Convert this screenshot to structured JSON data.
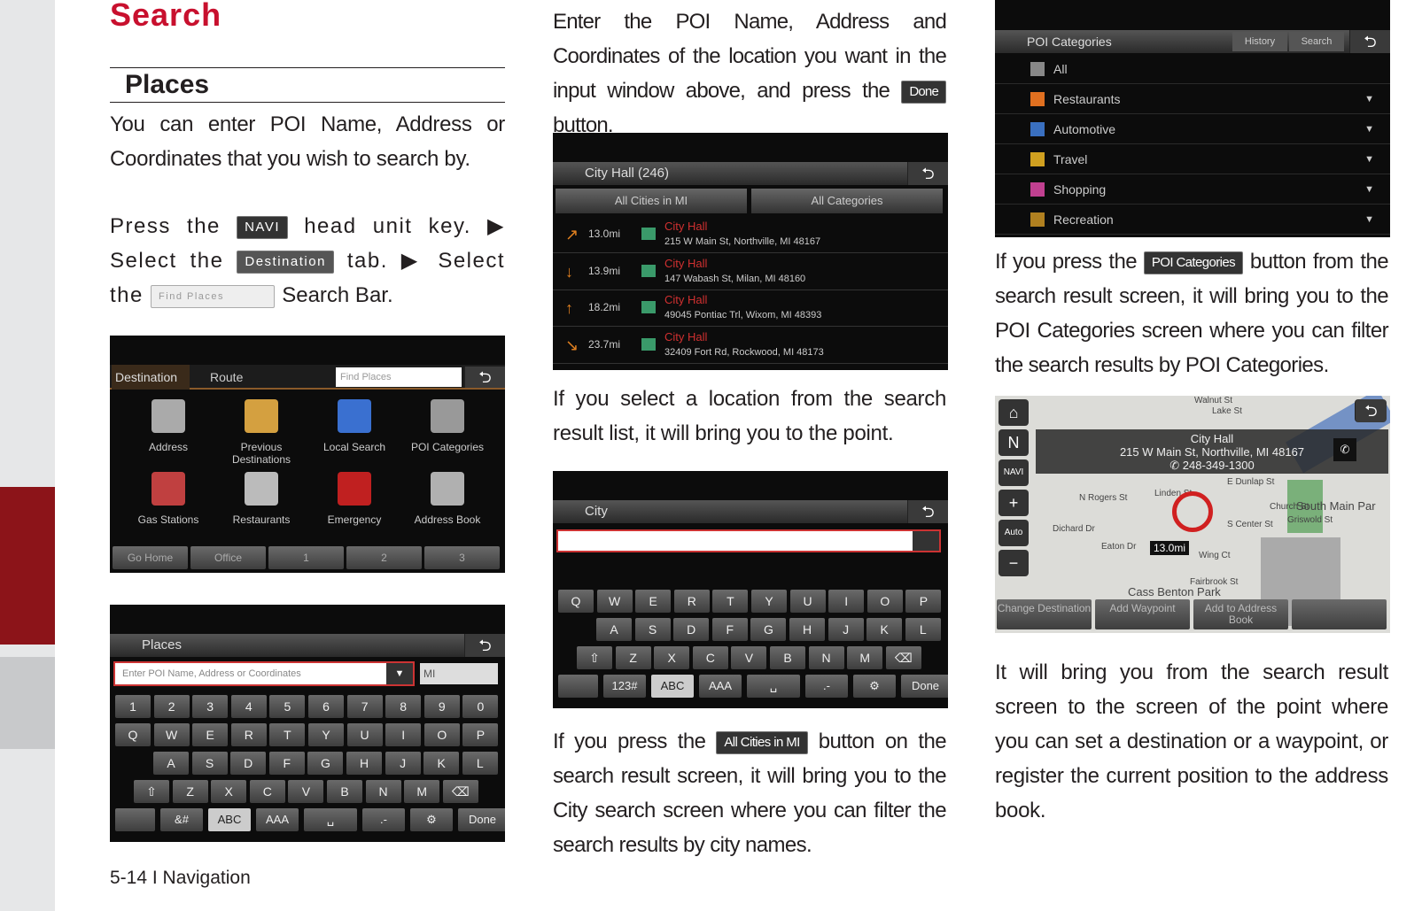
{
  "page": {
    "title": "Search",
    "section": "Places",
    "footer": "5-14 I Navigation"
  },
  "col1": {
    "intro": "You can enter POI Name, Address or Coordinates that you wish to search by.",
    "step_a": "Press the",
    "navi_chip": "NAVI",
    "step_b": "head unit key. ▶ Select the",
    "dest_chip": "Destination",
    "step_c": "tab. ▶ Select the",
    "find_chip": "Find Places",
    "step_d": "Search Bar."
  },
  "screen1": {
    "tabs": [
      "Destination",
      "Route"
    ],
    "search_placeholder": "Find Places",
    "items": [
      "Address",
      "Previous Destinations",
      "Local Search",
      "POI Categories",
      "Gas Stations",
      "Restaurants",
      "Emergency",
      "Address Book"
    ],
    "shortcuts": [
      "Go Home",
      "Office",
      "1",
      "2",
      "3"
    ]
  },
  "screen2": {
    "title": "Places",
    "input_placeholder": "Enter POI Name, Address or Coordinates",
    "state": "MI",
    "rows": [
      [
        "1",
        "2",
        "3",
        "4",
        "5",
        "6",
        "7",
        "8",
        "9",
        "0"
      ],
      [
        "Q",
        "W",
        "E",
        "R",
        "T",
        "Y",
        "U",
        "I",
        "O",
        "P"
      ],
      [
        "A",
        "S",
        "D",
        "F",
        "G",
        "H",
        "J",
        "K",
        "L"
      ],
      [
        "⇧",
        "Z",
        "X",
        "C",
        "V",
        "B",
        "N",
        "M",
        "⌫"
      ]
    ],
    "bottom": [
      "",
      "&#",
      "ABC",
      "AAA",
      "␣",
      ".-",
      "⚙",
      "Done"
    ]
  },
  "col2": {
    "p1a": "Enter the POI Name, Address and Coordinates of the location you want in the input window above, and press the",
    "done_chip": "Done",
    "p1b": "button.",
    "p2": "If you select a location from the search result list, it will bring you to the point.",
    "p3a": "If you press the",
    "allcities_chip": "All Cities in MI",
    "p3b": "button on the search result screen, it will bring you to the City search screen where you can filter the search results by city names."
  },
  "screen3": {
    "title": "City Hall (246)",
    "filters": [
      "All Cities in MI",
      "All Categories"
    ],
    "results": [
      {
        "dist": "13.0mi",
        "name": "City Hall",
        "addr": "215 W Main St, Northville, MI 48167",
        "arrow": "↗"
      },
      {
        "dist": "13.9mi",
        "name": "City Hall",
        "addr": "147 Wabash St, Milan, MI 48160",
        "arrow": "↓"
      },
      {
        "dist": "18.2mi",
        "name": "City Hall",
        "addr": "49045 Pontiac Trl, Wixom, MI 48393",
        "arrow": "↑"
      },
      {
        "dist": "23.7mi",
        "name": "City Hall",
        "addr": "32409 Fort Rd, Rockwood, MI 48173",
        "arrow": "↘"
      }
    ]
  },
  "screen4": {
    "title": "City",
    "rows": [
      [
        "Q",
        "W",
        "E",
        "R",
        "T",
        "Y",
        "U",
        "I",
        "O",
        "P"
      ],
      [
        "A",
        "S",
        "D",
        "F",
        "G",
        "H",
        "J",
        "K",
        "L"
      ],
      [
        "⇧",
        "Z",
        "X",
        "C",
        "V",
        "B",
        "N",
        "M",
        "⌫"
      ]
    ],
    "bottom": [
      "",
      "123#",
      "ABC",
      "AAA",
      "␣",
      ".-",
      "⚙",
      "Done"
    ]
  },
  "screen5": {
    "title": "POI Categories",
    "buttons": [
      "History",
      "Search"
    ],
    "categories": [
      "All",
      "Restaurants",
      "Automotive",
      "Travel",
      "Shopping",
      "Recreation"
    ],
    "colors": [
      "#888",
      "#e07020",
      "#3a70c0",
      "#d0a020",
      "#c04090",
      "#b08020"
    ]
  },
  "col3": {
    "p1a": "If you press the",
    "poi_chip": "POI Categories",
    "p1b": "button from the search result screen, it will bring you to the POI Categories screen where you can filter the search results by POI Categories.",
    "p2": "It will bring you from the search result screen to the screen of the point where you can set a destination or a waypoint, or register the current position to the address book."
  },
  "screen6": {
    "name": "City Hall",
    "address": "215 W Main St, Northville, MI 48167",
    "phone": "248-349-1300",
    "distance": "13.0mi",
    "streets": [
      "Walnut St",
      "Lake St",
      "E Dunlap St",
      "N Rogers St",
      "Linden St",
      "Dichard Dr",
      "Eaton Dr",
      "Wing Ct",
      "Fairbrook St",
      "Cass Benton Park",
      "South Main Par",
      "S Center St",
      "Church St",
      "Griswold St"
    ],
    "actions": [
      "Change Destination",
      "Add Waypoint",
      "Add to Address Book",
      ""
    ],
    "side": [
      "⌂",
      "N",
      "NAVI",
      "+",
      "Auto",
      "−"
    ]
  }
}
